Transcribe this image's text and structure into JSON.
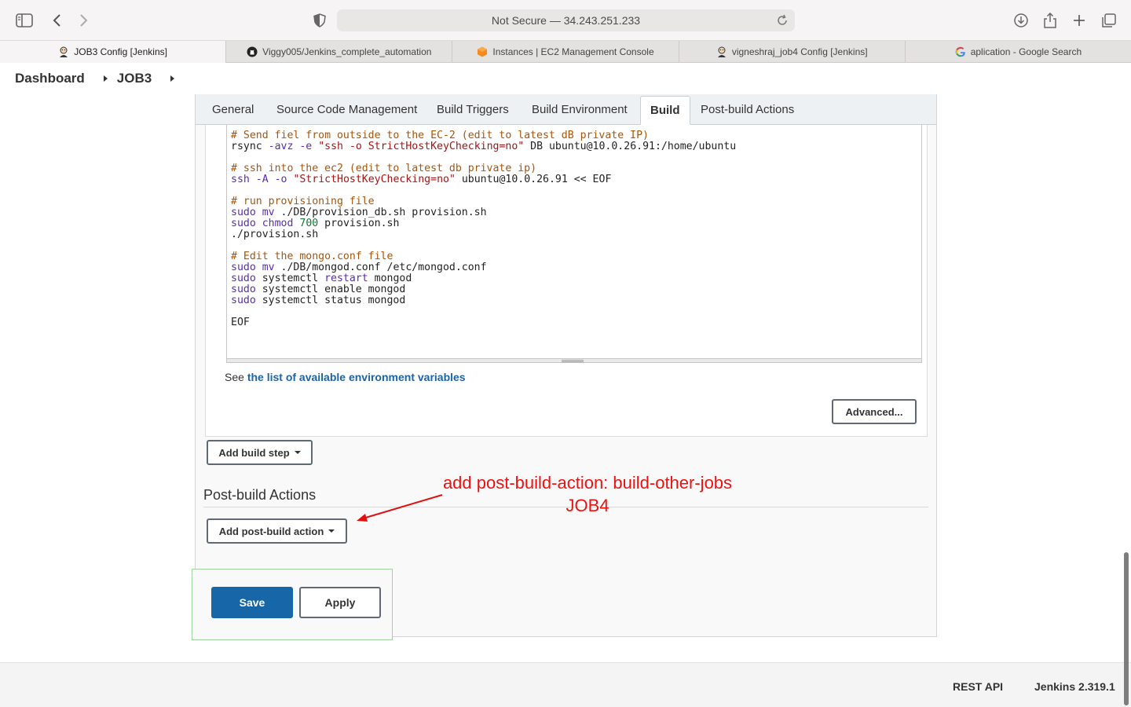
{
  "browser": {
    "address": "Not Secure — 34.243.251.233",
    "tabs": [
      {
        "label": "JOB3 Config [Jenkins]",
        "icon": "jenkins-icon",
        "active": true
      },
      {
        "label": "Viggy005/Jenkins_complete_automation",
        "icon": "github-icon",
        "active": false
      },
      {
        "label": "Instances | EC2 Management Console",
        "icon": "aws-icon",
        "active": false
      },
      {
        "label": "vigneshraj_job4 Config [Jenkins]",
        "icon": "jenkins-icon",
        "active": false
      },
      {
        "label": "aplication - Google Search",
        "icon": "google-icon",
        "active": false
      }
    ]
  },
  "breadcrumb": {
    "dashboard": "Dashboard",
    "job": "JOB3"
  },
  "config_tabs": [
    "General",
    "Source Code Management",
    "Build Triggers",
    "Build Environment",
    "Build",
    "Post-build Actions"
  ],
  "active_tab": "Build",
  "code_lines": [
    [
      {
        "t": "# Send fiel from outside to the EC-2 (edit to latest dB private IP)",
        "c": "com"
      }
    ],
    [
      {
        "t": "rsync ",
        "c": ""
      },
      {
        "t": "-avz",
        "c": "kw"
      },
      {
        "t": " ",
        "c": ""
      },
      {
        "t": "-e",
        "c": "kw"
      },
      {
        "t": " ",
        "c": ""
      },
      {
        "t": "\"ssh -o StrictHostKeyChecking=no\"",
        "c": "str"
      },
      {
        "t": " DB ubuntu@10.0.26.91:/home/ubuntu",
        "c": ""
      }
    ],
    [
      {
        "t": "",
        "c": ""
      }
    ],
    [
      {
        "t": "# ssh into the ec2 (edit to latest db private ip)",
        "c": "com"
      }
    ],
    [
      {
        "t": "ssh ",
        "c": "kw"
      },
      {
        "t": "-A",
        "c": "kw"
      },
      {
        "t": " ",
        "c": ""
      },
      {
        "t": "-o",
        "c": "kw"
      },
      {
        "t": " ",
        "c": ""
      },
      {
        "t": "\"StrictHostKeyChecking=no\"",
        "c": "str"
      },
      {
        "t": " ubuntu@10.0.26.91 << EOF",
        "c": ""
      }
    ],
    [
      {
        "t": "",
        "c": ""
      }
    ],
    [
      {
        "t": "# run provisioning file",
        "c": "com"
      }
    ],
    [
      {
        "t": "sudo",
        "c": "kw"
      },
      {
        "t": " ",
        "c": ""
      },
      {
        "t": "mv",
        "c": "kw"
      },
      {
        "t": " ./DB/provision_db.sh provision.sh",
        "c": ""
      }
    ],
    [
      {
        "t": "sudo",
        "c": "kw"
      },
      {
        "t": " ",
        "c": ""
      },
      {
        "t": "chmod",
        "c": "kw"
      },
      {
        "t": " ",
        "c": ""
      },
      {
        "t": "700",
        "c": "num"
      },
      {
        "t": " provision.sh",
        "c": ""
      }
    ],
    [
      {
        "t": "./provision.sh",
        "c": ""
      }
    ],
    [
      {
        "t": "",
        "c": ""
      }
    ],
    [
      {
        "t": "# Edit the mongo.conf file",
        "c": "com"
      }
    ],
    [
      {
        "t": "sudo",
        "c": "kw"
      },
      {
        "t": " ",
        "c": ""
      },
      {
        "t": "mv",
        "c": "kw"
      },
      {
        "t": " ./DB/mongod.conf /etc/mongod.conf",
        "c": ""
      }
    ],
    [
      {
        "t": "sudo",
        "c": "kw"
      },
      {
        "t": " systemctl ",
        "c": ""
      },
      {
        "t": "restart",
        "c": "kw"
      },
      {
        "t": " mongod",
        "c": ""
      }
    ],
    [
      {
        "t": "sudo",
        "c": "kw"
      },
      {
        "t": " systemctl enable mongod",
        "c": ""
      }
    ],
    [
      {
        "t": "sudo",
        "c": "kw"
      },
      {
        "t": " systemctl status mongod",
        "c": ""
      }
    ],
    [
      {
        "t": "",
        "c": ""
      }
    ],
    [
      {
        "t": "EOF",
        "c": ""
      }
    ]
  ],
  "env_prefix": "See ",
  "env_link": "the list of available environment variables",
  "advanced_label": "Advanced...",
  "add_build_step_label": "Add build step",
  "post_build_title": "Post-build Actions",
  "add_post_build_label": "Add post-build action",
  "annotation": {
    "line1": "add post-build-action: build-other-jobs",
    "line2": "JOB4",
    "color": "#e11111"
  },
  "save_label": "Save",
  "apply_label": "Apply",
  "footer": {
    "rest_api": "REST API",
    "version": "Jenkins 2.319.1"
  }
}
